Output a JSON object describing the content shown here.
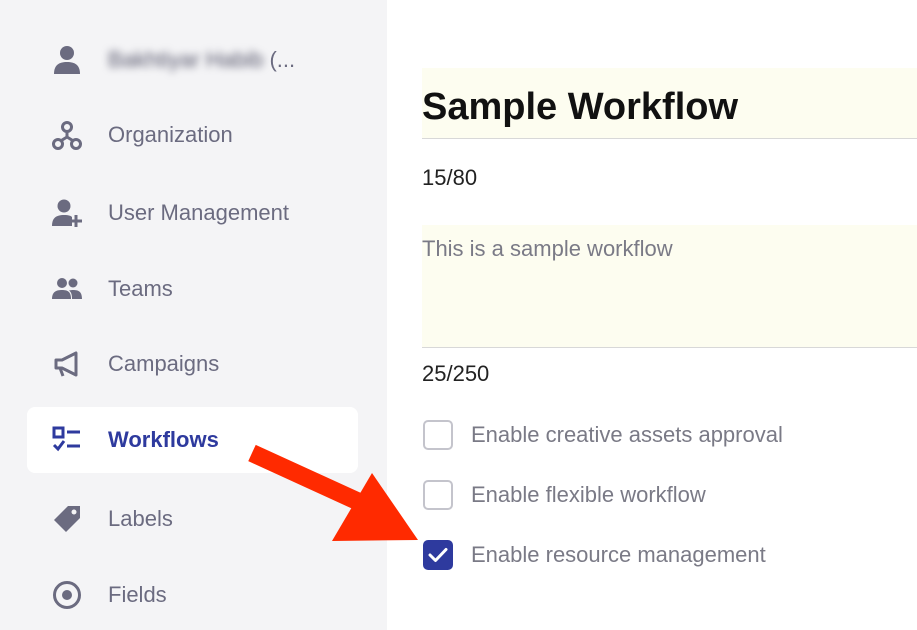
{
  "sidebar": {
    "user": {
      "name": "Bakhtiyar Habib",
      "suffix": "(..."
    },
    "items": [
      {
        "label": "Organization",
        "icon": "organization-icon"
      },
      {
        "label": "User Management",
        "icon": "user-add-icon"
      },
      {
        "label": "Teams",
        "icon": "teams-icon"
      },
      {
        "label": "Campaigns",
        "icon": "megaphone-icon"
      },
      {
        "label": "Workflows",
        "icon": "checklist-icon",
        "active": true
      },
      {
        "label": "Labels",
        "icon": "tag-icon"
      },
      {
        "label": "Fields",
        "icon": "target-icon"
      }
    ]
  },
  "main": {
    "title": "Sample Workflow",
    "title_counter": "15/80",
    "description": "This is a sample workflow",
    "description_counter": "25/250",
    "options": [
      {
        "label": "Enable creative assets approval",
        "checked": false
      },
      {
        "label": "Enable flexible workflow",
        "checked": false
      },
      {
        "label": "Enable resource management",
        "checked": true
      }
    ]
  },
  "colors": {
    "accent": "#2e3a9e",
    "sidebar_bg": "#f4f4f6",
    "field_bg": "#fdfdf0",
    "annotation_arrow": "#ff2a00"
  }
}
